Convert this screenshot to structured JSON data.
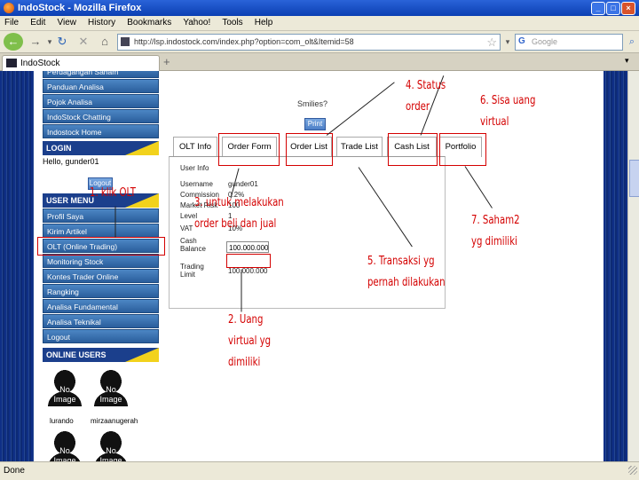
{
  "window": {
    "title": "IndoStock - Mozilla Firefox"
  },
  "menu": [
    "File",
    "Edit",
    "View",
    "History",
    "Bookmarks",
    "Yahoo!",
    "Tools",
    "Help"
  ],
  "navbar": {
    "url": "http://lsp.indostock.com/index.php?option=com_olt&Itemid=58",
    "search_placeholder": "Google"
  },
  "tab": {
    "label": "IndoStock",
    "new_tab": "+"
  },
  "sidebar": {
    "top_items": [
      "Perdagangan Saham",
      "Panduan Analisa",
      "Pojok Analisa",
      "IndoStock Chatting",
      "Indostock Home"
    ],
    "login_header": "LOGIN",
    "greeting": "Hello, gunder01",
    "logout_button": "Logout",
    "user_menu_header": "USER MENU",
    "user_items": [
      "Profil Saya",
      "Kirim Artikel",
      "OLT (Online Trading)",
      "Monitoring Stock",
      "Kontes Trader Online",
      "Rangking",
      "Analisa Fundamental",
      "Analisa Teknikal",
      "Logout"
    ],
    "online_users_header": "ONLINE USERS",
    "users": [
      {
        "name": "lurando",
        "no_image": "No Image"
      },
      {
        "name": "mirzaanugerah",
        "no_image": "No Image"
      },
      {
        "name": "",
        "no_image": "No Image"
      },
      {
        "name": "",
        "no_image": "No Image"
      }
    ]
  },
  "olt": {
    "smilies": "Smilies?",
    "print_button": "Print",
    "tabs": [
      "OLT Info",
      "Order Form",
      "Order List",
      "Trade List",
      "Cash List",
      "Portfolio"
    ],
    "section": "User Info",
    "rows": [
      {
        "label": "Username",
        "value": "gunder01"
      },
      {
        "label": "Commission",
        "value": "0.2%"
      },
      {
        "label": "Market Risk",
        "value": "100"
      },
      {
        "label": "Level",
        "value": "1"
      },
      {
        "label": "VAT",
        "value": "10%"
      }
    ],
    "cash_balance_label": "Cash Balance",
    "cash_balance_value": "100.000.000",
    "trading_limit_label": "Trading Limit",
    "trading_limit_value": "100.000.000"
  },
  "annotations": {
    "a1": "1. klik OLT",
    "a2": [
      "2. Uang",
      "virtual yg",
      "dimiliki"
    ],
    "a3": [
      "3. untuk melakukan",
      "order beli dan jual"
    ],
    "a4": [
      "4. Status",
      "order"
    ],
    "a5": [
      "5. Transaksi yg",
      "pernah dilakukan"
    ],
    "a6": [
      "6. Sisa uang",
      "virtual"
    ],
    "a7": [
      "7. Saham2",
      "yg dimiliki"
    ]
  },
  "status": {
    "text": "Done"
  }
}
